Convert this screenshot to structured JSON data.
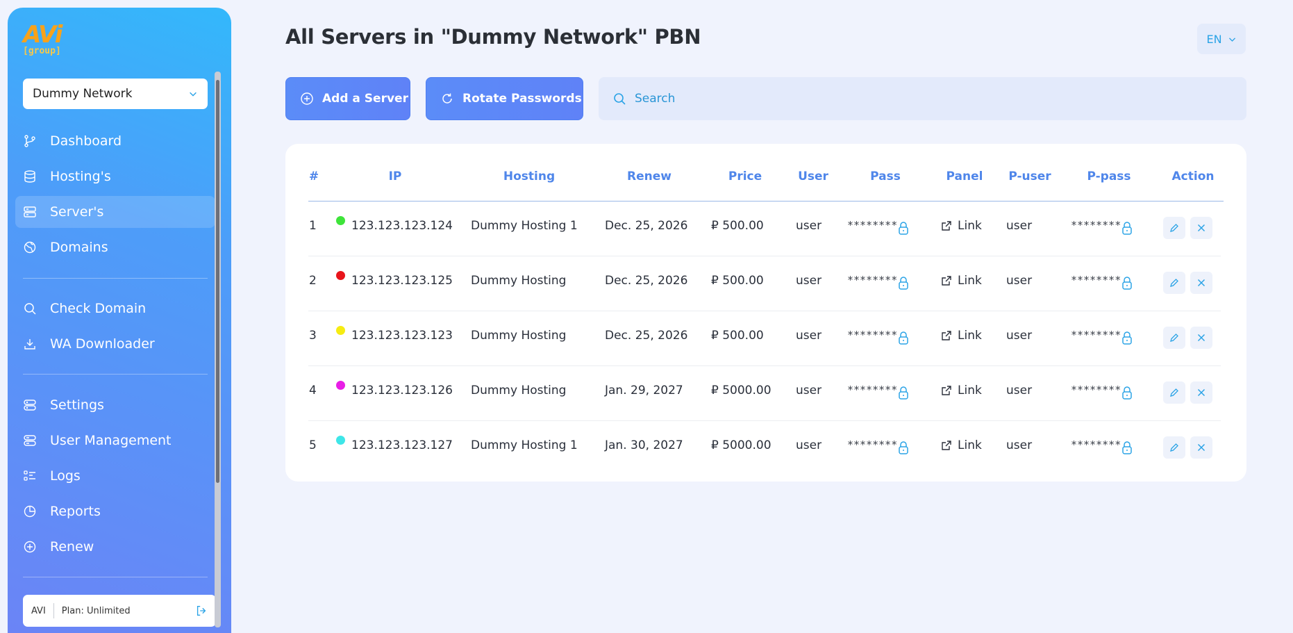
{
  "sidebar": {
    "logo": {
      "brand": "AVi",
      "sub": "[group]"
    },
    "network_select": "Dummy Network",
    "nav": [
      {
        "label": "Dashboard",
        "icon": "branch-icon"
      },
      {
        "label": "Hosting's",
        "icon": "database-icon"
      },
      {
        "label": "Server's",
        "icon": "server-icon"
      },
      {
        "label": "Domains",
        "icon": "globe-icon"
      },
      {
        "label": "Check Domain",
        "icon": "search-icon"
      },
      {
        "label": "WA Downloader",
        "icon": "download-icon"
      },
      {
        "label": "Settings",
        "icon": "settings-icon"
      },
      {
        "label": "User Management",
        "icon": "users-icon"
      },
      {
        "label": "Logs",
        "icon": "list-icon"
      },
      {
        "label": "Reports",
        "icon": "pie-chart-icon"
      },
      {
        "label": "Renew",
        "icon": "plus-circle-icon"
      }
    ],
    "active_item": "Server's",
    "account": {
      "user": "AVI",
      "plan": "Plan: Unlimited"
    }
  },
  "header": {
    "title": "All Servers in \"Dummy Network\" PBN",
    "language": "EN"
  },
  "toolbar": {
    "add_label": "Add a Server",
    "rotate_label": "Rotate Passwords",
    "search_placeholder": "Search"
  },
  "table": {
    "columns": [
      "#",
      "IP",
      "Hosting",
      "Renew",
      "Price",
      "User",
      "Pass",
      "Panel",
      "P-user",
      "P-pass",
      "Action"
    ],
    "rows": [
      {
        "num": "1",
        "status_color": "#3ee43a",
        "ip": "123.123.123.124",
        "hosting": "Dummy Hosting 1",
        "renew": "Dec. 25, 2026",
        "price": "₽ 500.00",
        "user": "user",
        "pass": "********",
        "panel": "Link",
        "puser": "user",
        "ppass": "********"
      },
      {
        "num": "2",
        "status_color": "#e8141b",
        "ip": "123.123.123.125",
        "hosting": "Dummy Hosting",
        "renew": "Dec. 25, 2026",
        "price": "₽ 500.00",
        "user": "user",
        "pass": "********",
        "panel": "Link",
        "puser": "user",
        "ppass": "********"
      },
      {
        "num": "3",
        "status_color": "#f6ec12",
        "ip": "123.123.123.123",
        "hosting": "Dummy Hosting",
        "renew": "Dec. 25, 2026",
        "price": "₽ 500.00",
        "user": "user",
        "pass": "********",
        "panel": "Link",
        "puser": "user",
        "ppass": "********"
      },
      {
        "num": "4",
        "status_color": "#e81ee6",
        "ip": "123.123.123.126",
        "hosting": "Dummy Hosting",
        "renew": "Jan. 29, 2027",
        "price": "₽ 5000.00",
        "user": "user",
        "pass": "********",
        "panel": "Link",
        "puser": "user",
        "ppass": "********"
      },
      {
        "num": "5",
        "status_color": "#3ee6e8",
        "ip": "123.123.123.127",
        "hosting": "Dummy Hosting 1",
        "renew": "Jan. 30, 2027",
        "price": "₽ 5000.00",
        "user": "user",
        "pass": "********",
        "panel": "Link",
        "puser": "user",
        "ppass": "********"
      }
    ]
  },
  "colors": {
    "accent": "#4f86ea",
    "icon_blue": "#2aa3e6",
    "button": "#5b8cf8"
  }
}
